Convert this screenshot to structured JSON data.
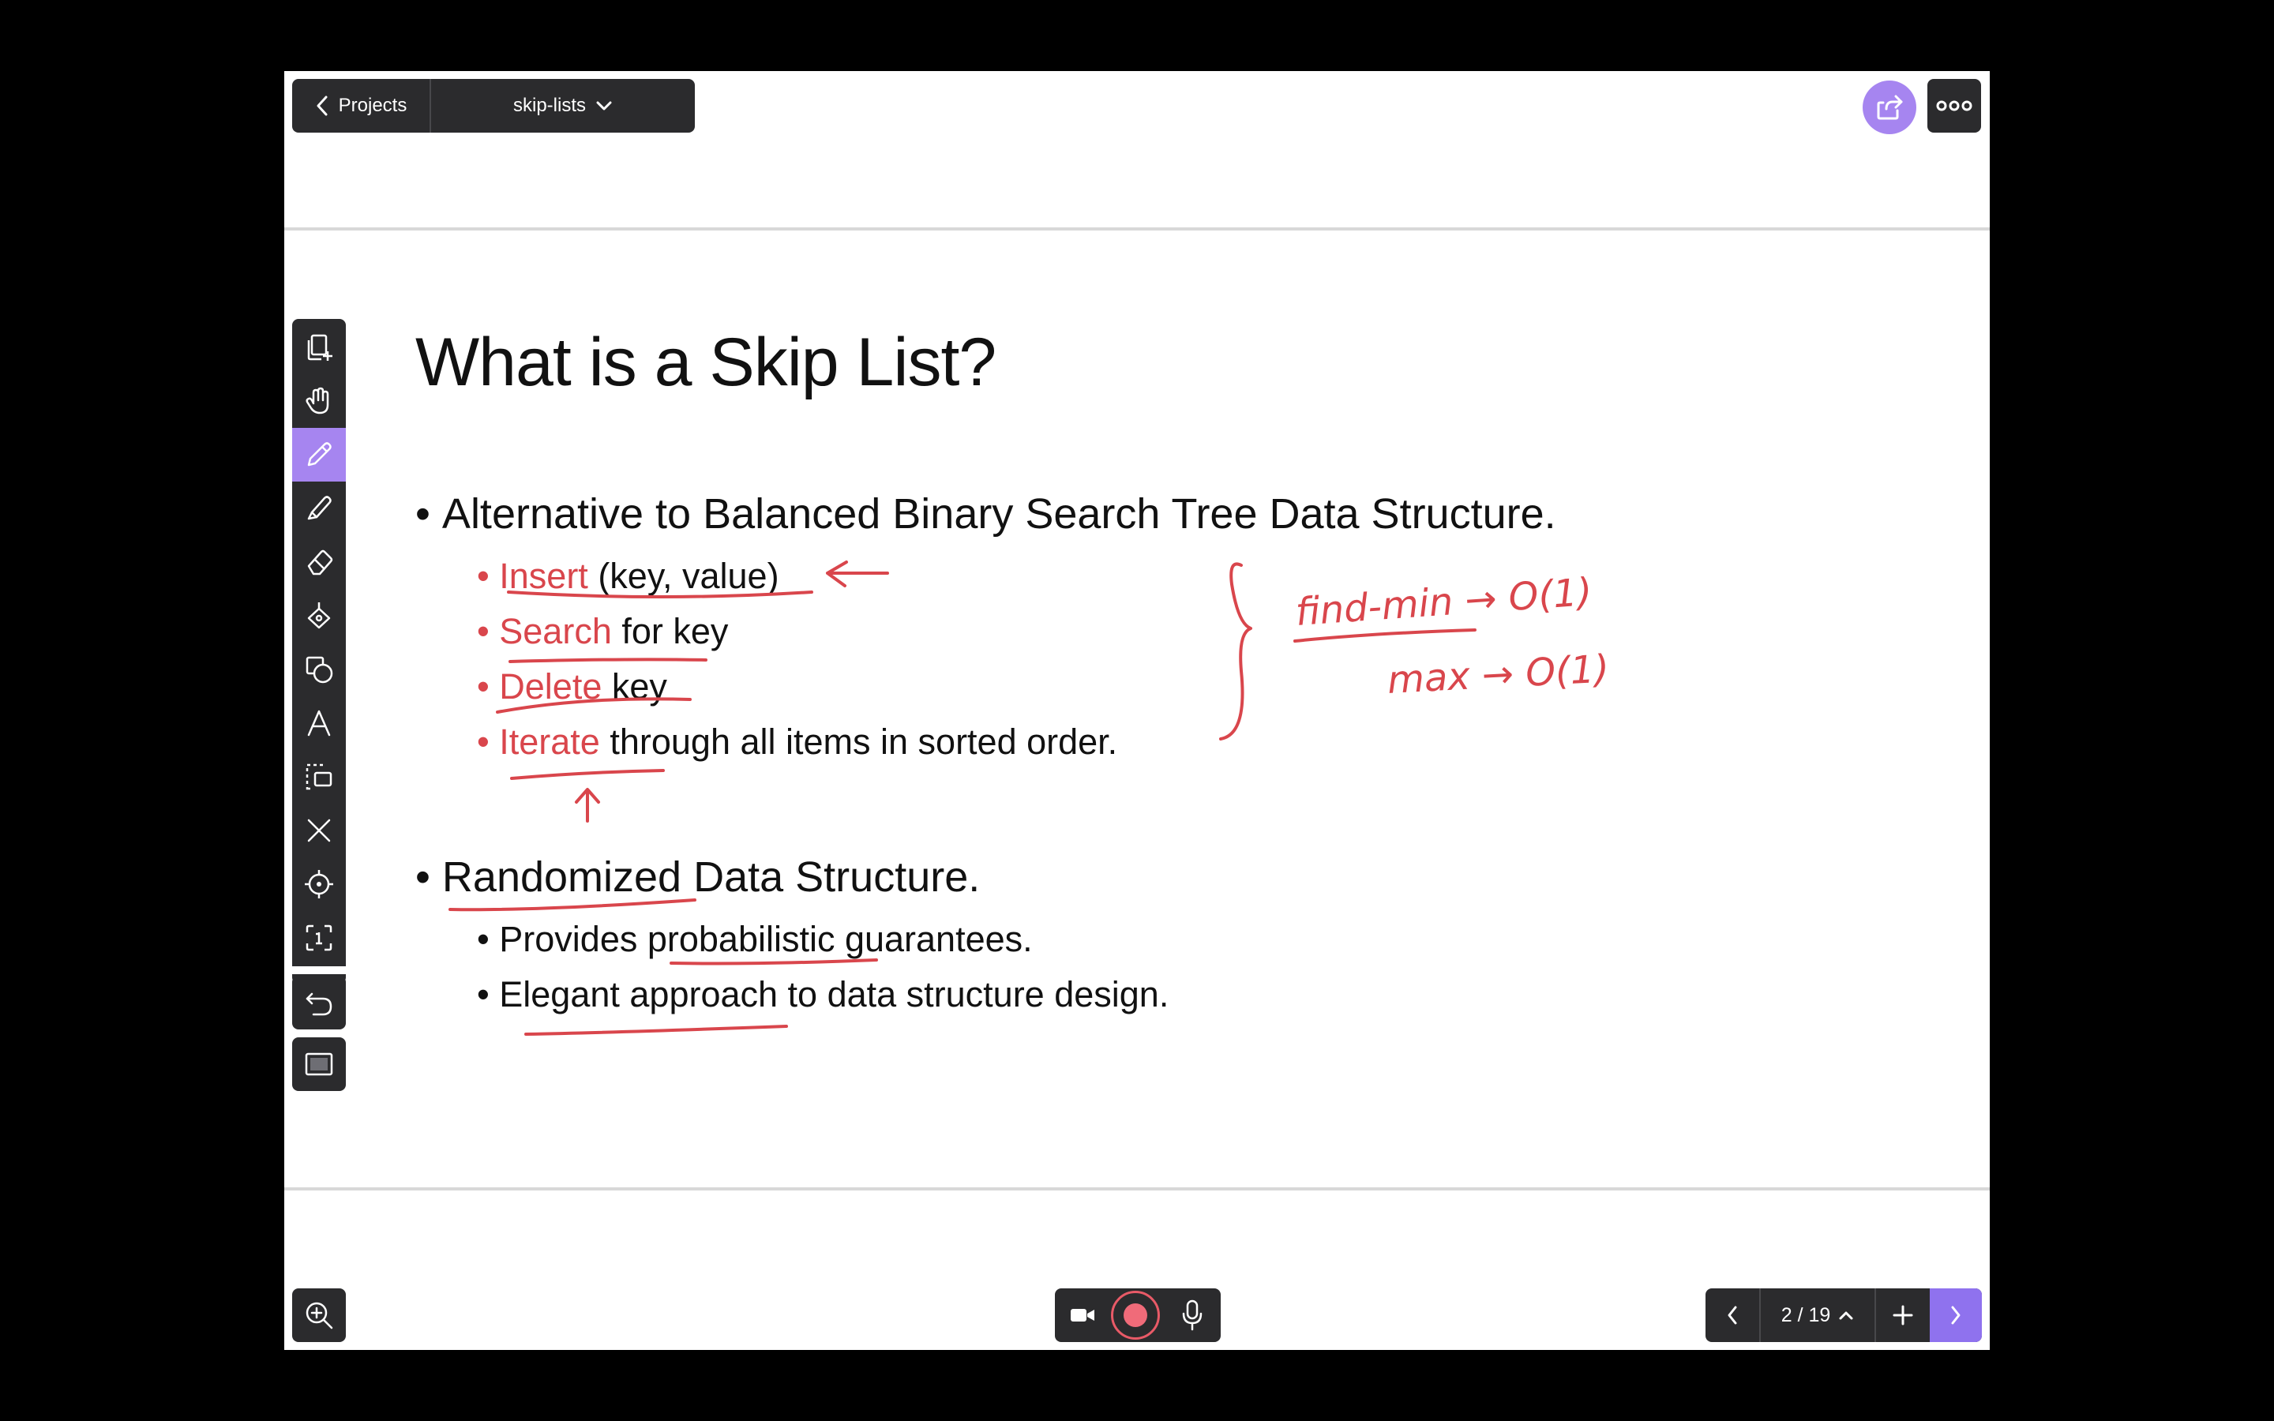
{
  "header": {
    "back_label": "Projects",
    "project_name": "skip-lists"
  },
  "slide": {
    "title": "What is a Skip List?",
    "bullets": [
      {
        "text": "Alternative to Balanced Binary Search Tree Data Structure.",
        "sub": [
          {
            "highlight": "Insert",
            "rest": " (key, value)"
          },
          {
            "highlight": "Search",
            "rest": " for key"
          },
          {
            "highlight": "Delete",
            "rest": " key"
          },
          {
            "highlight": "Iterate",
            "rest": " through all items in sorted order."
          }
        ]
      },
      {
        "text": "Randomized Data Structure.",
        "sub": [
          {
            "text": "Provides probabilistic guarantees."
          },
          {
            "text": "Elegant approach to data structure design."
          }
        ]
      }
    ]
  },
  "annotations": {
    "line1": "find-min → O(1)",
    "line2": "max → O(1)"
  },
  "toolbar": {
    "tools": [
      "add-page-icon",
      "hand-icon",
      "pen-icon",
      "highlighter-icon",
      "eraser-icon",
      "fill-icon",
      "shapes-icon",
      "text-icon",
      "select-icon",
      "close-icon",
      "laser-pointer-icon",
      "screen-capture-icon",
      "undo-icon",
      "display-icon"
    ],
    "active_tool": "pen-icon"
  },
  "footer": {
    "page_label": "2 / 19"
  },
  "colors": {
    "accent": "#a685f0",
    "ink_red": "#d9464c",
    "bar": "#2b2b2d"
  }
}
